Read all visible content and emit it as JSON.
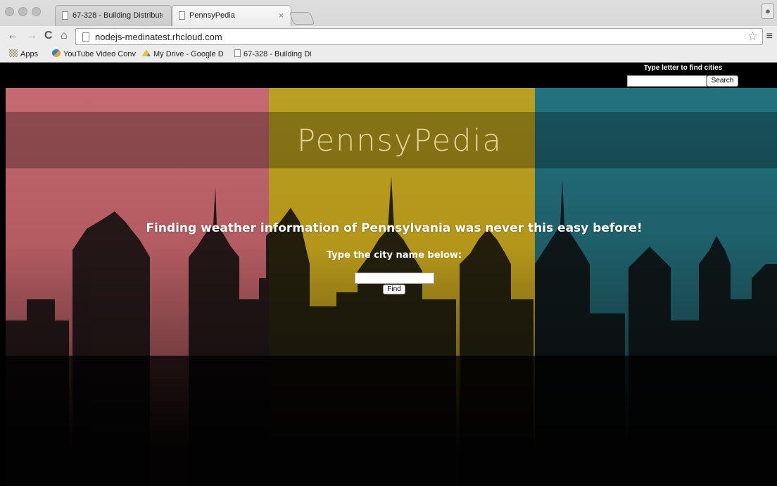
{
  "browser": {
    "tabs": [
      {
        "label": "67-328 - Building Distribut",
        "active": false
      },
      {
        "label": "PennsyPedia",
        "active": true
      }
    ],
    "url": "nodejs-medinatest.rhcloud.com",
    "bookmarks": [
      {
        "label": "Apps",
        "icon": "apps-grid-icon"
      },
      {
        "label": "YouTube Video Conv",
        "icon": "converter-icon"
      },
      {
        "label": "My Drive - Google D",
        "icon": "google-drive-icon"
      },
      {
        "label": "67-328 - Building Di",
        "icon": "page-icon"
      }
    ]
  },
  "page": {
    "top_search_label": "Type letter to find cities",
    "top_search_button": "Search",
    "title": "PennsyPedia",
    "headline": "Finding weather information of Pennsylvania was never this easy before!",
    "subheading": "Type the city name below:",
    "find_button": "Find"
  },
  "colors": {
    "panel_left": "#b65c62",
    "panel_middle": "#b59a1a",
    "panel_right": "#22636f",
    "title_color": "#f0e1aa"
  }
}
